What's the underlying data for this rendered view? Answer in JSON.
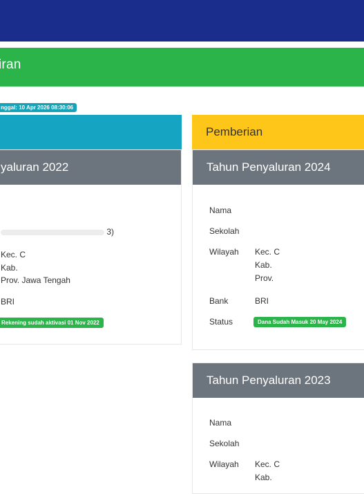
{
  "header": {
    "section_title": "iran"
  },
  "timestamp": "nggal: 10 Apr 2026 08:30:06",
  "left_column": {
    "year_header": "yaluran 2022",
    "wilayah_lines": [
      "Kec. C",
      "Kab.",
      "Prov. Jawa Tengah"
    ],
    "sekolah_tail": "3)",
    "bank": "BRI",
    "status_badge": "Rekening sudah aktivasi 01 Nov 2022"
  },
  "right_top": {
    "type_header": "Pemberian",
    "year_header": "Tahun Penyaluran 2024",
    "labels": {
      "nama": "Nama",
      "sekolah": "Sekolah",
      "wilayah": "Wilayah",
      "bank": "Bank",
      "status": "Status"
    },
    "wilayah_lines": [
      "Kec. C",
      "Kab.",
      "Prov."
    ],
    "bank": "BRI",
    "status_badge": "Dana Sudah Masuk 20 May 2024"
  },
  "right_bottom": {
    "year_header": "Tahun Penyaluran 2023",
    "labels": {
      "nama": "Nama",
      "sekolah": "Sekolah",
      "wilayah": "Wilayah"
    },
    "wilayah_lines": [
      "Kec. C",
      "Kab."
    ]
  },
  "colors": {
    "navy": "#1a2d8c",
    "green": "#2bb44a",
    "cyan": "#15a4c1",
    "yellow": "#ffc61a",
    "gray": "#6c757d"
  }
}
